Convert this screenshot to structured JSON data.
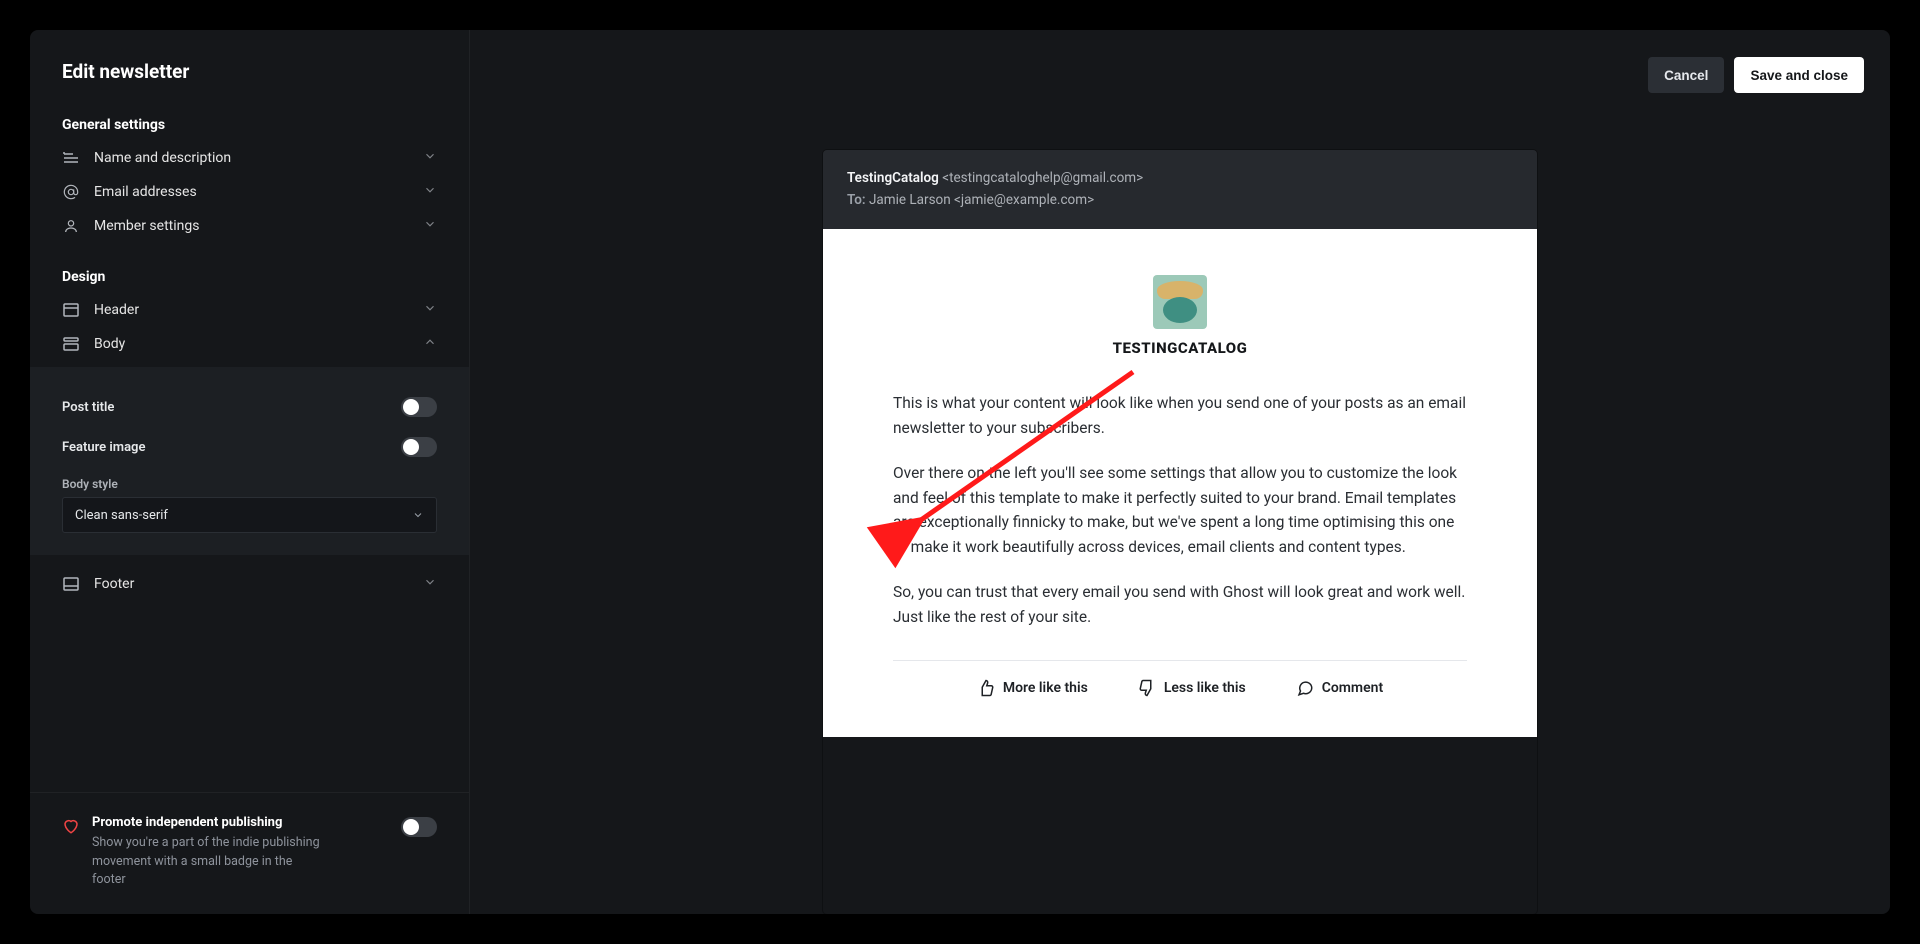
{
  "panel_title": "Edit newsletter",
  "sections": {
    "general_label": "General settings",
    "design_label": "Design"
  },
  "rows": {
    "name_desc": "Name and description",
    "email_addresses": "Email addresses",
    "member_settings": "Member settings",
    "header": "Header",
    "body": "Body",
    "footer": "Footer"
  },
  "body_panel": {
    "post_title_label": "Post title",
    "feature_image_label": "Feature image",
    "body_style_label": "Body style",
    "body_style_value": "Clean sans-serif"
  },
  "promote": {
    "title": "Promote independent publishing",
    "desc": "Show you're a part of the indie publishing movement with a small badge in the footer"
  },
  "toolbar": {
    "cancel": "Cancel",
    "save": "Save and close"
  },
  "email": {
    "from_name": "TestingCatalog",
    "from_email": "<testingcataloghelp@gmail.com>",
    "to_label": "To:",
    "to_value": "Jamie Larson <jamie@example.com>",
    "brand_upper": "TESTINGCATALOG",
    "p1": "This is what your content will look like when you send one of your posts as an email newsletter to your subscribers.",
    "p2": "Over there on the left you'll see some settings that allow you to customize the look and feel of this template to make it perfectly suited to your brand. Email templates are exceptionally finnicky to make, but we've spent a long time optimising this one to make it work beautifully across devices, email clients and content types.",
    "p3": "So, you can trust that every email you send with Ghost will look great and work well. Just like the rest of your site.",
    "actions": {
      "more": "More like this",
      "less": "Less like this",
      "comment": "Comment"
    }
  }
}
